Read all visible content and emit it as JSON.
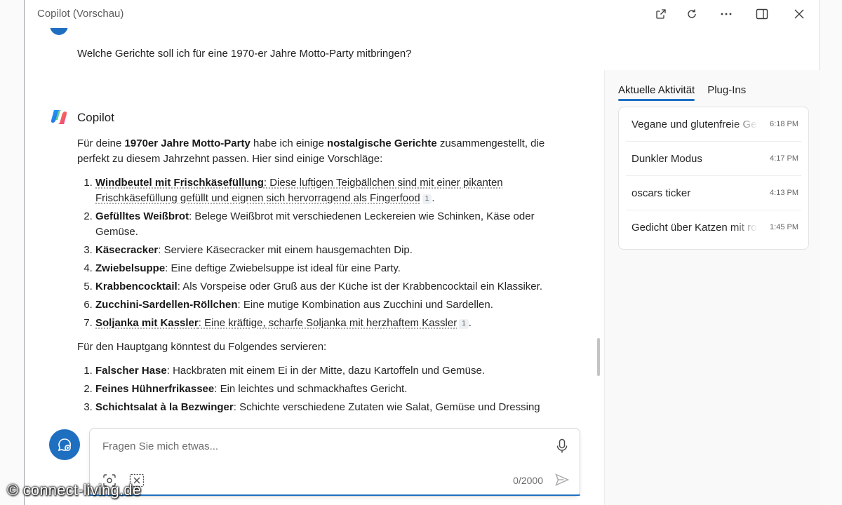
{
  "window": {
    "title": "Copilot (Vorschau)"
  },
  "titlebar_icons": [
    "open-external-icon",
    "refresh-icon",
    "more-icon",
    "sidebar-toggle-icon",
    "close-icon"
  ],
  "chat": {
    "user_message": "Welche Gerichte soll ich für eine 1970-er Jahre Motto-Party mitbringen?",
    "bot_name": "Copilot",
    "intro_parts": {
      "a": "Für deine ",
      "b": "1970er Jahre Motto-Party",
      "c": " habe ich einige ",
      "d": "nostalgische Gerichte",
      "e": " zusammengestellt, die perfekt zu diesem Jahrzehnt passen. Hier sind einige Vorschläge:"
    },
    "starters": [
      {
        "name": "Windbeutel mit Frischkäsefüllung",
        "text": ": Diese luftigen Teigbällchen sind mit einer pikanten Frischkäsefüllung gefüllt und eignen sich hervorragend als Fingerfood",
        "cite": "1",
        "end": "."
      },
      {
        "name": "Gefülltes Weißbrot",
        "text": ": Belege Weißbrot mit verschiedenen Leckereien wie Schinken, Käse oder Gemüse."
      },
      {
        "name": "Käsecracker",
        "text": ": Serviere Käsecracker mit einem hausgemachten Dip."
      },
      {
        "name": "Zwiebelsuppe",
        "text": ": Eine deftige Zwiebelsuppe ist ideal für eine Party."
      },
      {
        "name": "Krabbencocktail",
        "text": ": Als Vorspeise oder Gruß aus der Küche ist der Krabbencocktail ein Klassiker."
      },
      {
        "name": "Zucchini-Sardellen-Röllchen",
        "text": ": Eine mutige Kombination aus Zucchini und Sardellen."
      },
      {
        "name": "Soljanka mit Kassler",
        "text": ": Eine kräftige, scharfe Soljanka mit herzhaftem Kassler",
        "cite": "1",
        "end": "."
      }
    ],
    "main_intro": "Für den Hauptgang könntest du Folgendes servieren:",
    "mains": [
      {
        "name": "Falscher Hase",
        "text": ": Hackbraten mit einem Ei in der Mitte, dazu Kartoffeln und Gemüse."
      },
      {
        "name": "Feines Hühnerfrikassee",
        "text": ": Ein leichtes und schmackhaftes Gericht."
      },
      {
        "name": "Schichtsalat à la Bezwinger",
        "text": ": Schichte verschiedene Zutaten wie Salat, Gemüse und Dressing"
      }
    ]
  },
  "input": {
    "placeholder": "Fragen Sie mich etwas...",
    "counter": "0/2000"
  },
  "side": {
    "tabs": [
      "Aktuelle Aktivität",
      "Plug-Ins"
    ],
    "activity": [
      {
        "title": "Vegane und glutenfreie Ge",
        "time": "6:18 PM"
      },
      {
        "title": "Dunkler Modus",
        "time": "4:17 PM"
      },
      {
        "title": "oscars ticker",
        "time": "4:13 PM"
      },
      {
        "title": "Gedicht über Katzen mit ro",
        "time": "1:45 PM"
      }
    ]
  },
  "watermark": "© connect-living.de",
  "colors": {
    "accent": "#1f6fc1",
    "side_bg": "#f9f9f9"
  }
}
